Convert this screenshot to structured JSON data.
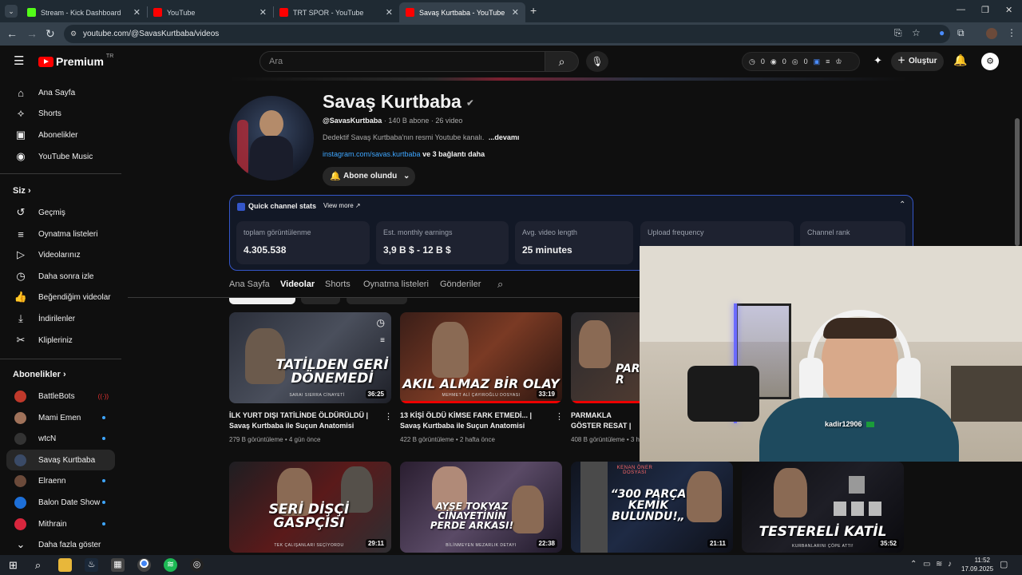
{
  "browser": {
    "tabs": [
      {
        "label": "Stream - Kick Dashboard",
        "color": "#53fc18"
      },
      {
        "label": "YouTube",
        "color": "#ff0000"
      },
      {
        "label": "TRT SPOR - YouTube",
        "color": "#ff0000"
      },
      {
        "label": "Savaş Kurtbaba - YouTube",
        "color": "#ff0000"
      }
    ],
    "url": "youtube.com/@SavasKurtbaba/videos"
  },
  "yt": {
    "logo": "Premium",
    "logo_region": "TR",
    "search_placeholder": "Ara",
    "stats": [
      "0",
      "0",
      "0"
    ],
    "create_label": "Oluştur"
  },
  "sidebar": {
    "main": [
      {
        "label": "Ana Sayfa",
        "icon": "home-icon"
      },
      {
        "label": "Shorts",
        "icon": "shorts-icon"
      },
      {
        "label": "Abonelikler",
        "icon": "subscriptions-icon"
      },
      {
        "label": "YouTube Music",
        "icon": "music-icon"
      }
    ],
    "you_header": "Siz",
    "you": [
      {
        "label": "Geçmiş",
        "icon": "history-icon"
      },
      {
        "label": "Oynatma listeleri",
        "icon": "playlist-icon"
      },
      {
        "label": "Videolarınız",
        "icon": "your-videos-icon"
      },
      {
        "label": "Daha sonra izle",
        "icon": "watch-later-icon"
      },
      {
        "label": "Beğendiğim videolar",
        "icon": "like-icon"
      },
      {
        "label": "İndirilenler",
        "icon": "download-icon"
      },
      {
        "label": "Klipleriniz",
        "icon": "clips-icon"
      }
    ],
    "subs_header": "Abonelikler",
    "subs": [
      {
        "label": "BattleBots",
        "color": "#c0392b"
      },
      {
        "label": "Mami Emen",
        "color": "#a0725a"
      },
      {
        "label": "wtcN",
        "color": "#222222"
      },
      {
        "label": "Savaş Kurtbaba",
        "color": "#3a4a66"
      },
      {
        "label": "Elraenn",
        "color": "#6b4a3a"
      },
      {
        "label": "Balon Date Show",
        "color": "#1d6fd8"
      },
      {
        "label": "Mithrain",
        "color": "#d8263d"
      }
    ],
    "more_label": "Daha fazla göster"
  },
  "channel": {
    "name": "Savaş Kurtbaba",
    "handle": "@SavasKurtbaba",
    "subscribers": "140 B abone",
    "video_count": "26 video",
    "description": "Dedektif Savaş Kurtbaba'nın resmi Youtube kanalı.",
    "more": "...devamı",
    "link": "instagram.com/savas.kurtbaba",
    "link_more": "ve 3 bağlantı daha",
    "subscribed_label": "Abone olundu"
  },
  "quick_stats": {
    "title": "Quick channel stats",
    "view_more": "View more",
    "items": [
      {
        "label": "toplam görüntülenme",
        "value": "4.305.538"
      },
      {
        "label": "Est. monthly earnings",
        "value": "3,9 B $ - 12 B $"
      },
      {
        "label": "Avg. video length",
        "value": "25 minutes"
      },
      {
        "label": "Upload frequency",
        "value": ""
      },
      {
        "label": "Channel rank",
        "value": ""
      }
    ]
  },
  "channel_tabs": [
    "Ana Sayfa",
    "Videolar",
    "Shorts",
    "Oynatma listeleri",
    "Gönderiler"
  ],
  "videos": [
    {
      "thumb_text": "TATİLDEN GERİ DÖNEMEDİ",
      "thumb_sub": "SARAI SIERRA CİNAYETİ",
      "duration": "36:25",
      "title": "İLK YURT DIŞI TATİLİNDE ÖLDÜRÜLDÜ | Savaş Kurtbaba ile Suçun Anatomisi",
      "views": "279 B görüntüleme",
      "age": "4 gün önce"
    },
    {
      "thumb_text": "AKIL ALMAZ BİR OLAY",
      "thumb_sub": "MEHMET ALİ ÇAYIROĞLU DOSYASI",
      "duration": "33:19",
      "title": "13 KİŞİ ÖLDÜ KİMSE FARK ETMEDİ... | Savaş Kurtbaba ile Suçun Anatomisi",
      "views": "422 B görüntüleme",
      "age": "2 hafta önce"
    },
    {
      "thumb_text": "PAR R",
      "thumb_sub": "",
      "duration": "",
      "title": "PARMAKLA GÖSTER RESAT | Savaş Kurtb",
      "views": "408 B görüntüleme",
      "age": "3 h"
    },
    {
      "thumb_text": "SERİ DİŞÇİ GASPÇISI",
      "thumb_sub": "TEK ÇALIŞANLARI SEÇİYORDU",
      "duration": "29:11"
    },
    {
      "thumb_text": "AYŞE TOKYAZ CİNAYETİNİN PERDE ARKASI!",
      "thumb_sub": "BİLİNMEYEN MEZARLIK DETAYI",
      "duration": "22:38"
    },
    {
      "thumb_text": "“300 PARÇA KEMİK BULUNDU!„",
      "thumb_sub": "KENAN ÖNER DOSYASI",
      "duration": "21:11"
    },
    {
      "thumb_text": "TESTERELİ KATİL",
      "thumb_sub": "KURBANLARINI ÇÖPE ATTI!",
      "duration": "35:52"
    }
  ],
  "webcam": {
    "username": "kadir12906"
  },
  "taskbar": {
    "time": "11:52",
    "date": "17.09.2025"
  }
}
